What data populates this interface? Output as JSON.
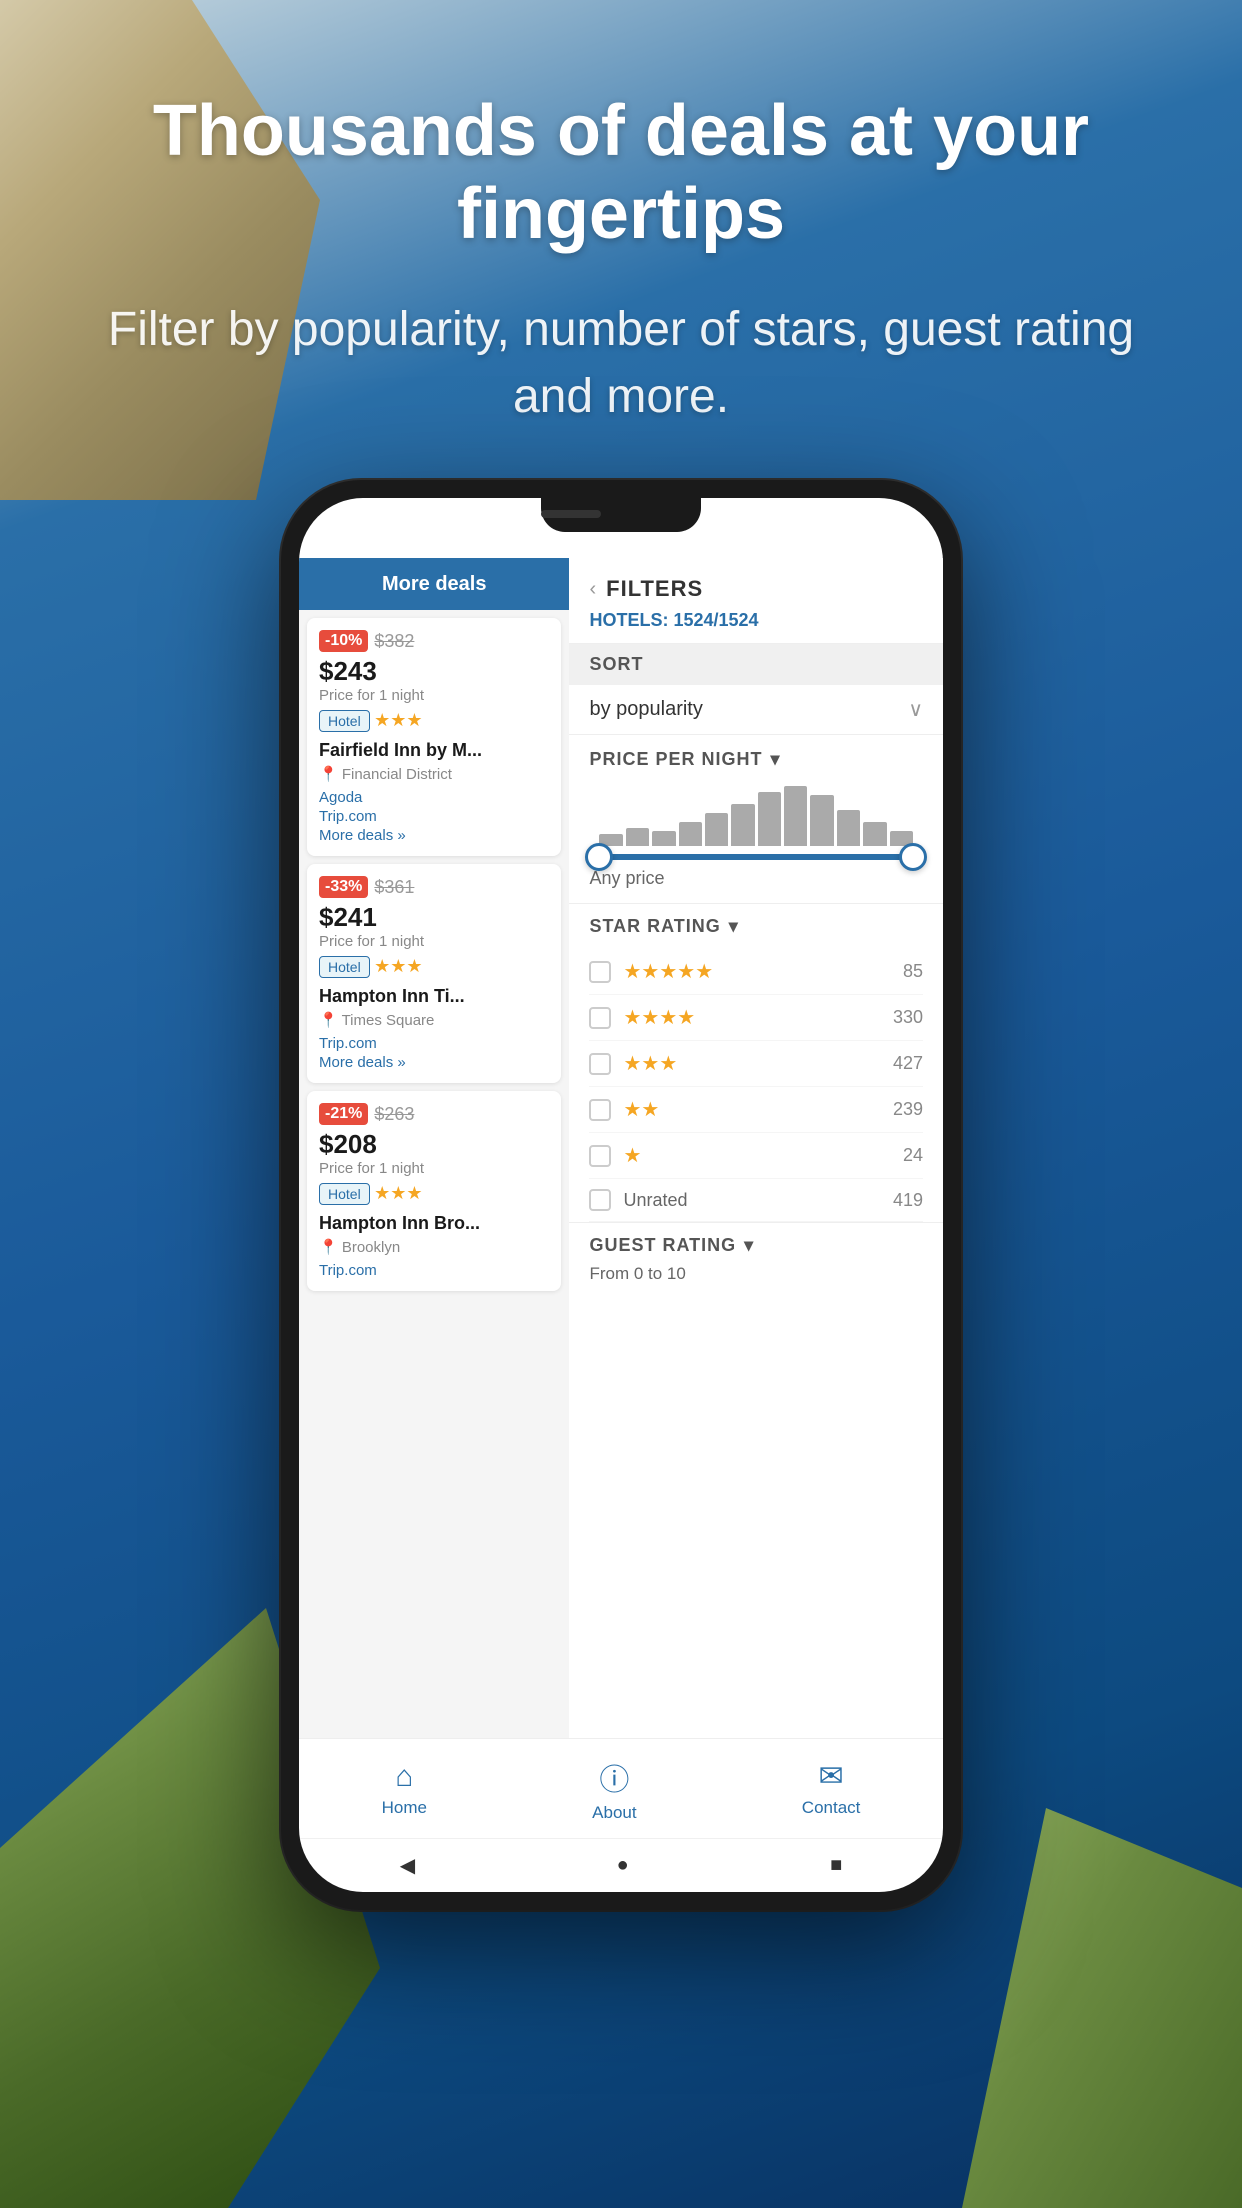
{
  "background": {
    "color_top": "#2a6fa8",
    "color_bottom": "#083060"
  },
  "hero": {
    "title": "Thousands of deals at your fingertips",
    "subtitle": "Filter by popularity, number of stars, guest rating and more."
  },
  "phone": {
    "top_bar": {
      "more_deals": "More deals"
    },
    "filter": {
      "title": "FILTERS",
      "hotels_label": "HOTELS:",
      "hotels_count": "1524/1524",
      "sort_section": "SORT",
      "sort_value": "by popularity",
      "price_section": "PRICE PER NIGHT",
      "price_value": "Any price",
      "star_section": "STAR RATING",
      "stars": [
        {
          "count": 5,
          "num": 85
        },
        {
          "count": 4,
          "num": 330
        },
        {
          "count": 3,
          "num": 427
        },
        {
          "count": 2,
          "num": 239
        },
        {
          "count": 1,
          "num": 24
        },
        {
          "count": 0,
          "label": "Unrated",
          "num": 419
        }
      ],
      "guest_rating_section": "GUEST RATING",
      "guest_rating_range": "From  0 to 10"
    },
    "hotels": [
      {
        "discount": "-10%",
        "original_price": "$382",
        "current_price": "$243",
        "price_label": "Price for 1 night",
        "badge": "Hotel",
        "stars": 3,
        "name": "Fairfield Inn by M...",
        "location": "Financial District",
        "links": [
          "Agoda",
          "Trip.com",
          "More deals »"
        ]
      },
      {
        "discount": "-33%",
        "original_price": "$361",
        "current_price": "$241",
        "price_label": "Price for 1 night",
        "badge": "Hotel",
        "stars": 3,
        "name": "Hampton Inn Ti...",
        "location": "Times Square",
        "links": [
          "Trip.com",
          "More deals »"
        ]
      },
      {
        "discount": "-21%",
        "original_price": "$263",
        "current_price": "$208",
        "price_label": "Price for 1 night",
        "badge": "Hotel",
        "stars": 3,
        "name": "Hampton Inn Bro...",
        "location": "Brooklyn",
        "links": [
          "Trip.com"
        ]
      }
    ],
    "bottom_nav": [
      {
        "icon": "🏠",
        "label": "Home"
      },
      {
        "icon": "ℹ",
        "label": "About"
      },
      {
        "icon": "✉",
        "label": "Contact"
      }
    ],
    "android_nav": [
      "◀",
      "●",
      "■"
    ]
  }
}
